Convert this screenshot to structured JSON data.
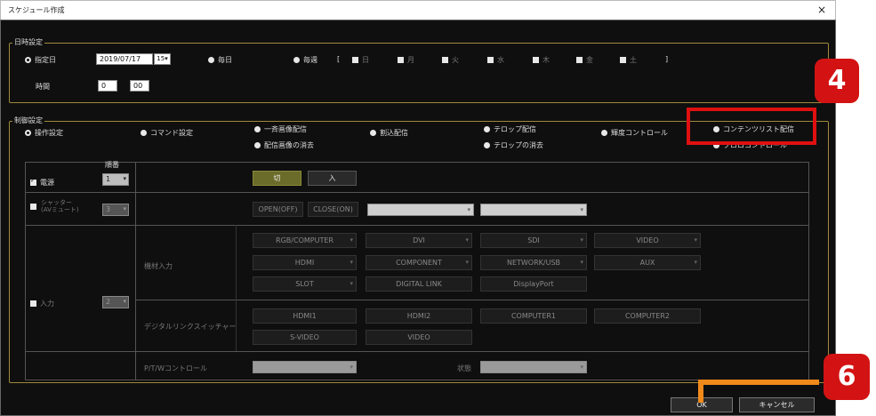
{
  "window": {
    "title": "スケジュール作成",
    "close_icon": "×"
  },
  "datetime": {
    "group_label": "日時設定",
    "mode_specified": "指定日",
    "date_value": "2019/07/17",
    "date_btn": "15▾",
    "mode_daily": "毎日",
    "mode_weekly": "毎週",
    "bracket_open": "[",
    "bracket_close": "]",
    "days": [
      "日",
      "月",
      "火",
      "水",
      "木",
      "金",
      "土"
    ],
    "time_label": "時間",
    "hour": "0",
    "minute": "00"
  },
  "control": {
    "group_label": "制御設定",
    "modes": {
      "operation": "操作設定",
      "command": "コマンド設定",
      "broadcast_image": "一斉画像配信",
      "clear_image": "配信画像の消去",
      "interrupt": "割込配信",
      "telop": "テロップ配信",
      "clear_telop": "テロップの消去",
      "brightness": "輝度コントロール",
      "content_list": "コンテンツリスト配信",
      "partial": "プロロコントロール"
    },
    "order_label": "順番",
    "power": {
      "label": "電源",
      "order": "1",
      "off": "切",
      "on": "入"
    },
    "shutter": {
      "label_line1": "シャッター",
      "label_line2": "(AVミュート)",
      "order": "3",
      "open": "OPEN(OFF)",
      "close": "CLOSE(ON)"
    },
    "input": {
      "label": "入力",
      "order": "2",
      "device_label": "機材入力",
      "device_buttons": [
        "RGB/COMPUTER",
        "DVI",
        "SDI",
        "VIDEO",
        "HDMI",
        "COMPONENT",
        "NETWORK/USB",
        "AUX",
        "SLOT",
        "DIGITAL LINK",
        "DisplayPort"
      ],
      "switcher_label": "デジタルリンクスイッチャー",
      "switcher_buttons": [
        "HDMI1",
        "HDMI2",
        "COMPUTER1",
        "COMPUTER2",
        "S-VIDEO",
        "VIDEO"
      ]
    },
    "pan": {
      "label": "P/T/Wコントロール",
      "state_label": "状態"
    }
  },
  "footer": {
    "ok": "OK",
    "cancel": "キャンセル"
  },
  "annotations": {
    "step4": "4",
    "step6": "6"
  },
  "colors": {
    "highlight": "#e01010",
    "annot_badge": "#d31313",
    "orange_marker": "#f08a1a",
    "group_border": "#a08a3c"
  }
}
